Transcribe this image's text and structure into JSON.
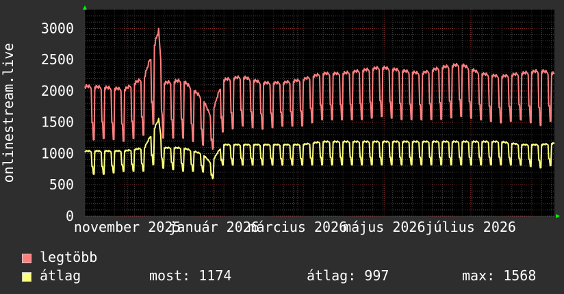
{
  "chart_data": {
    "type": "line",
    "ylabel": "onlinestream.live",
    "ylim": [
      0,
      3300
    ],
    "y_ticks": [
      0,
      500,
      1000,
      1500,
      2000,
      2500,
      3000
    ],
    "y_tick_labels": [
      "0",
      "500",
      "1000",
      "1500",
      "2000",
      "2500",
      "3000"
    ],
    "x_range": [
      "2025-10-02",
      "2026-08-29"
    ],
    "x_tick_labels": [
      {
        "date": "2025-11-01",
        "label": "november 2025"
      },
      {
        "date": "2026-01-01",
        "label": "január 2026"
      },
      {
        "date": "2026-03-01",
        "label": "március 2026"
      },
      {
        "date": "2026-05-01",
        "label": "május 2026"
      },
      {
        "date": "2026-07-01",
        "label": "július 2026"
      }
    ],
    "grid": true,
    "background": "#000000",
    "series": [
      {
        "name": "legtöbb",
        "color": "#ff7f7f",
        "x": [
          "2025-10-02",
          "2025-10-16",
          "2025-10-30",
          "2025-11-13",
          "2025-11-23",
          "2025-11-26",
          "2025-12-10",
          "2025-12-24",
          "2025-12-30",
          "2026-01-07",
          "2026-01-21",
          "2026-02-04",
          "2026-02-18",
          "2026-03-04",
          "2026-03-18",
          "2026-04-01",
          "2026-04-15",
          "2026-04-29",
          "2026-05-13",
          "2026-05-27",
          "2026-06-10",
          "2026-06-24",
          "2026-07-08",
          "2026-07-22",
          "2026-08-05",
          "2026-08-19",
          "2026-08-29"
        ],
        "values": [
          2100,
          2080,
          2050,
          2250,
          3000,
          2150,
          2200,
          1900,
          1600,
          2200,
          2250,
          2150,
          2150,
          2200,
          2300,
          2300,
          2350,
          2400,
          2350,
          2300,
          2400,
          2450,
          2300,
          2250,
          2300,
          2350,
          2300
        ],
        "low_values": [
          1150,
          1200,
          1150,
          1250,
          1500,
          1200,
          1200,
          1100,
          1000,
          1300,
          1400,
          1350,
          1400,
          1400,
          1500,
          1500,
          1500,
          1550,
          1500,
          1500,
          1500,
          1550,
          1500,
          1450,
          1500,
          1400,
          1500
        ]
      },
      {
        "name": "átlag",
        "color": "#ffff7f",
        "x": [
          "2025-10-02",
          "2025-10-16",
          "2025-10-30",
          "2025-11-13",
          "2025-11-23",
          "2025-11-26",
          "2025-12-10",
          "2025-12-24",
          "2025-12-30",
          "2026-01-07",
          "2026-01-21",
          "2026-02-04",
          "2026-02-18",
          "2026-03-04",
          "2026-03-18",
          "2026-04-01",
          "2026-04-15",
          "2026-04-29",
          "2026-05-13",
          "2026-05-27",
          "2026-06-10",
          "2026-06-24",
          "2026-07-08",
          "2026-07-22",
          "2026-08-05",
          "2026-08-19",
          "2026-08-29"
        ],
        "values": [
          1050,
          1050,
          1050,
          1100,
          1560,
          1100,
          1100,
          1000,
          850,
          1150,
          1150,
          1150,
          1150,
          1150,
          1200,
          1200,
          1200,
          1200,
          1200,
          1200,
          1200,
          1200,
          1200,
          1200,
          1150,
          1150,
          1174
        ],
        "low_values": [
          650,
          650,
          700,
          700,
          850,
          750,
          700,
          700,
          550,
          800,
          800,
          800,
          800,
          800,
          800,
          800,
          800,
          800,
          800,
          800,
          800,
          800,
          800,
          800,
          800,
          750,
          800
        ]
      }
    ]
  },
  "legend": {
    "series1": "legtöbb",
    "series2": "átlag",
    "most": "most: 1174",
    "atlag": "átlag: 997",
    "max": "max: 1568"
  },
  "colors": {
    "background": "#2e2e2e",
    "plot": "#000000",
    "grid_major": "#ff5a5a",
    "grid_minor": "#444444",
    "legtobb": "#ff7f7f",
    "atlag": "#ffff7f",
    "axis_arrow": "#00ff00"
  }
}
